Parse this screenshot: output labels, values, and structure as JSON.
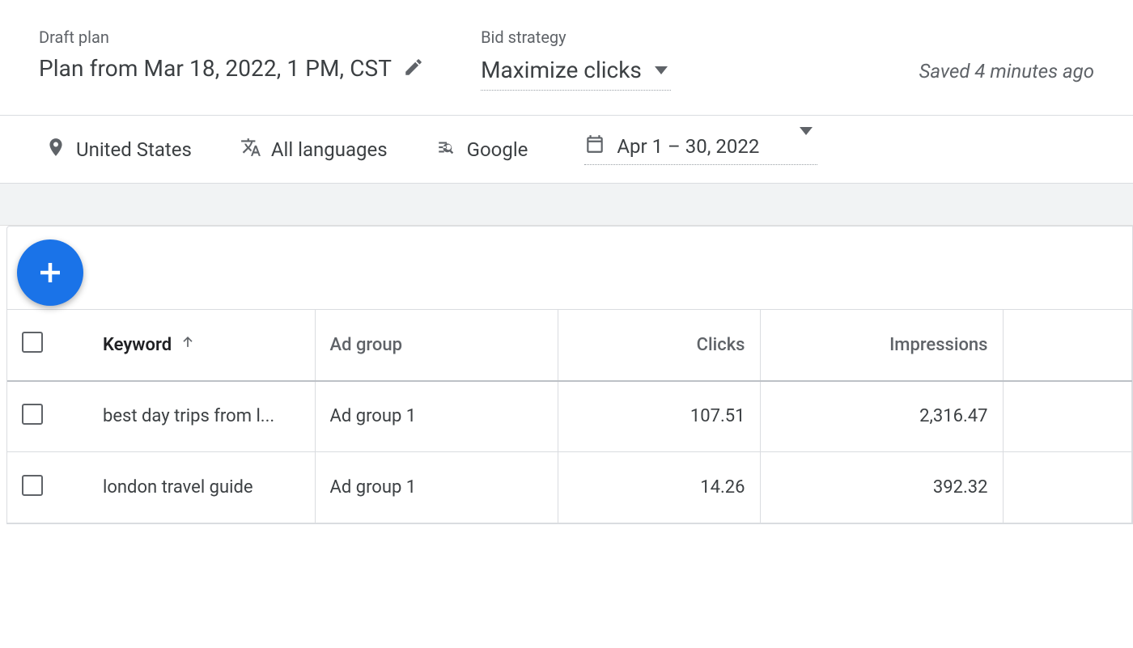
{
  "header": {
    "plan_label": "Draft plan",
    "plan_title": "Plan from Mar 18, 2022, 1 PM, CST",
    "bid_label": "Bid strategy",
    "bid_value": "Maximize clicks",
    "saved": "Saved 4 minutes ago"
  },
  "filters": {
    "location": "United States",
    "language": "All languages",
    "network": "Google",
    "date_range": "Apr 1 – 30, 2022"
  },
  "table": {
    "columns": {
      "keyword": "Keyword",
      "ad_group": "Ad group",
      "clicks": "Clicks",
      "impressions": "Impressions"
    },
    "rows": [
      {
        "keyword": "best day trips from l...",
        "ad_group": "Ad group 1",
        "clicks": "107.51",
        "impressions": "2,316.47"
      },
      {
        "keyword": "london travel guide",
        "ad_group": "Ad group 1",
        "clicks": "14.26",
        "impressions": "392.32"
      }
    ]
  }
}
